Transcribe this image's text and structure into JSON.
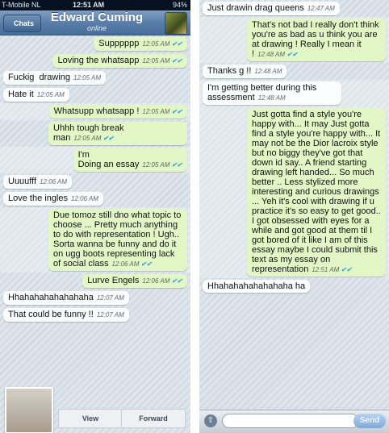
{
  "status": {
    "carrier": "T-Mobile NL",
    "time": "12:51 AM",
    "battery": "94%"
  },
  "header": {
    "back_label": "Chats",
    "contact_name": "Edward Cuming",
    "contact_status": "online"
  },
  "screen1_messages": [
    {
      "text": "Supppppp",
      "time": "12:05 AM",
      "direction": "out",
      "highlight": false
    },
    {
      "text": "Loving the whatsapp",
      "time": "12:05 AM",
      "direction": "out",
      "highlight": false
    },
    {
      "text": "Fuckig  drawing",
      "time": "12:05 AM",
      "direction": "in",
      "highlight": false
    },
    {
      "text": "Hate it",
      "time": "12:05 AM",
      "direction": "in",
      "highlight": false
    },
    {
      "text": "Whatsupp whatsapp !",
      "time": "12:05 AM",
      "direction": "out",
      "highlight": true
    },
    {
      "text": "Uhhh tough break man",
      "time": "12:05 AM",
      "direction": "out",
      "highlight": false
    },
    {
      "text": "I'm\nDoing an essay",
      "time": "12:05 AM",
      "direction": "out",
      "highlight": true
    },
    {
      "text": "Uuuufff",
      "time": "12:06 AM",
      "direction": "in",
      "highlight": false
    },
    {
      "text": "Love the ingles",
      "time": "12:06 AM",
      "direction": "in",
      "highlight": false
    },
    {
      "text": "Due tomoz still dno what topic to choose ... Pretty much anything to do with representation ! Ugh.. Sorta wanna be funny and do it on ugg boots representing lack of social class",
      "time": "12:06 AM",
      "direction": "out",
      "highlight": true
    },
    {
      "text": "Lurve Engels",
      "time": "12:06 AM",
      "direction": "out",
      "highlight": false
    },
    {
      "text": "Hhahahahahahahaha",
      "time": "12:07 AM",
      "direction": "in",
      "highlight": false
    },
    {
      "text": "That could be funny !!",
      "time": "12:07 AM",
      "direction": "in",
      "highlight": false
    }
  ],
  "attachment": {
    "view_label": "View",
    "forward_label": "Forward"
  },
  "screen2_messages": [
    {
      "text": "Just drawin drag queens",
      "time": "12:47 AM",
      "direction": "in",
      "highlight": false
    },
    {
      "text": "That's not bad I really don't think you're as bad as u think you are at drawing ! Really I mean it !",
      "time": "12:48 AM",
      "direction": "out",
      "highlight": true
    },
    {
      "text": "Thanks g !!",
      "time": "12:48 AM",
      "direction": "in",
      "highlight": false
    },
    {
      "text": "I'm getting better during this assessment",
      "time": "12:48 AM",
      "direction": "in",
      "highlight": true
    },
    {
      "text": "Just gotta find a style you're happy with... It may Just gotta find a style you're happy with... It may not be the Dior lacroix style but no biggy they've got that down id say.. A friend starting drawing left handed... So much better .. Less stylized more interesting and curious drawings ... Yeh it's cool with drawing if u practice it's so easy to get good.. I got obsessed with eyes for a while and got good at them til I got bored of it like I am of this essay maybe I could submit this text as my essay on representation",
      "time": "12:51 AM",
      "direction": "out",
      "highlight": true
    },
    {
      "text": "Hhahahahahahahaha ha",
      "time": "",
      "direction": "in",
      "highlight": false
    }
  ],
  "input": {
    "placeholder": "",
    "send_label": "Send"
  },
  "icons": {
    "tick": "double-check-icon",
    "upload": "arrow-up-icon"
  }
}
